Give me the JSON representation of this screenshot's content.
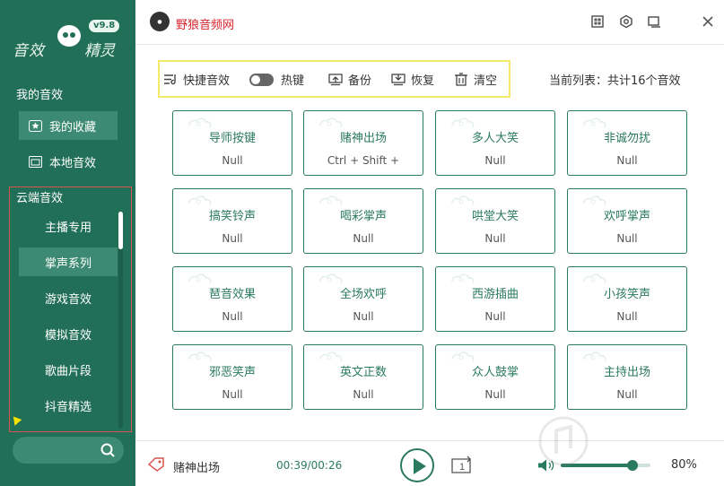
{
  "app": {
    "logo_left": "音效",
    "logo_right": "精灵",
    "version": "v9.8",
    "brand_name": "野狼音频网"
  },
  "sidebar": {
    "my_sounds_header": "我的音效",
    "my_items": [
      {
        "label": "我的收藏",
        "icon": "star-icon",
        "active": true
      },
      {
        "label": "本地音效",
        "icon": "folder-icon",
        "active": false
      }
    ],
    "cloud_header": "云端音效",
    "cloud_items": [
      {
        "label": "主播专用",
        "active": false
      },
      {
        "label": "掌声系列",
        "active": true
      },
      {
        "label": "游戏音效",
        "active": false
      },
      {
        "label": "模拟音效",
        "active": false
      },
      {
        "label": "歌曲片段",
        "active": false
      },
      {
        "label": "抖音精选",
        "active": false
      }
    ]
  },
  "toolbar": {
    "quick_label": "快捷音效",
    "hotkey_label": "热键",
    "backup_label": "备份",
    "restore_label": "恢复",
    "clear_label": "清空",
    "list_info": "当前列表：共计16个音效"
  },
  "cards": [
    {
      "title": "导师按键",
      "key": "Null"
    },
    {
      "title": "赌神出场",
      "key": "Ctrl + Shift +"
    },
    {
      "title": "多人大笑",
      "key": "Null"
    },
    {
      "title": "非诚勿扰",
      "key": "Null"
    },
    {
      "title": "搞笑铃声",
      "key": "Null"
    },
    {
      "title": "喝彩掌声",
      "key": "Null"
    },
    {
      "title": "哄堂大笑",
      "key": "Null"
    },
    {
      "title": "欢呼掌声",
      "key": "Null"
    },
    {
      "title": "琶音效果",
      "key": "Null"
    },
    {
      "title": "全场欢呼",
      "key": "Null"
    },
    {
      "title": "西游插曲",
      "key": "Null"
    },
    {
      "title": "小孩笑声",
      "key": "Null"
    },
    {
      "title": "邪恶笑声",
      "key": "Null"
    },
    {
      "title": "英文正数",
      "key": "Null"
    },
    {
      "title": "众人鼓掌",
      "key": "Null"
    },
    {
      "title": "主持出场",
      "key": "Null"
    }
  ],
  "player": {
    "now_playing": "赌神出场",
    "time": "00:39/00:26",
    "repeat_label": "1",
    "volume_text": "80%",
    "volume_level": 0.8
  },
  "colors": {
    "sidebar": "#226f58",
    "accent": "#2a7a5f",
    "brand": "#d9232d",
    "toolbar_border": "#f5e96b",
    "cloud_border": "#d9534f"
  }
}
